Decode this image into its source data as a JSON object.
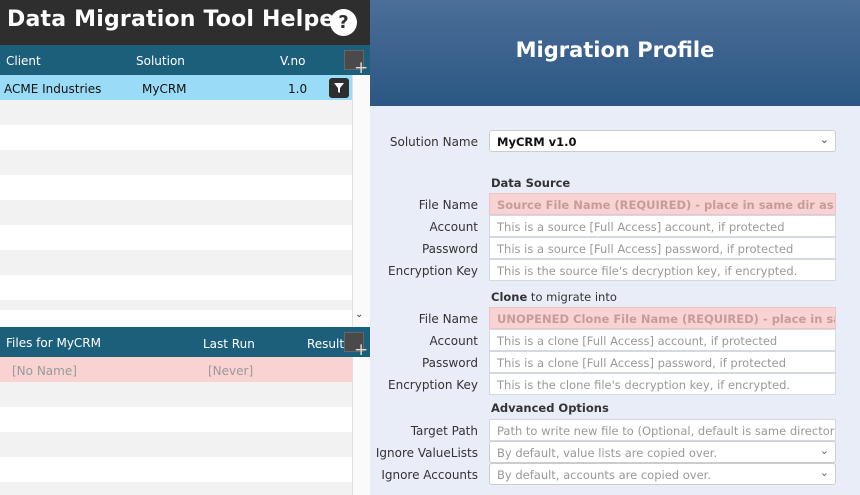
{
  "app": {
    "title": "Data Migration Tool Helper",
    "help_label": "?"
  },
  "clients": {
    "headers": {
      "client": "Client",
      "solution": "Solution",
      "version": "V.no"
    },
    "add_label": "+",
    "rows": [
      {
        "client": "ACME Industries",
        "solution": "MyCRM",
        "version": "1.0"
      }
    ]
  },
  "files": {
    "headers": {
      "files_for": "Files for MyCRM",
      "last_run": "Last Run",
      "result": "Result"
    },
    "add_label": "+",
    "rows": [
      {
        "name": "[No Name]",
        "last_run": "[Never]"
      }
    ]
  },
  "profile": {
    "title": "Migration Profile",
    "solution_name": {
      "label": "Solution Name",
      "value": "MyCRM v1.0"
    },
    "data_source": {
      "title": "Data Source",
      "file_name": {
        "label": "File Name",
        "placeholder": "Source File Name (REQUIRED) - place in same dir as this"
      },
      "account": {
        "label": "Account",
        "placeholder": "This is a source [Full Access] account, if protected"
      },
      "password": {
        "label": "Password",
        "placeholder": "This is a source [Full Access] password, if protected"
      },
      "encryption": {
        "label": "Encryption Key",
        "placeholder": "This is the source file's decryption key, if encrypted."
      }
    },
    "clone": {
      "title": "Clone to migrate into",
      "file_name": {
        "label": "File Name",
        "placeholder": "UNOPENED Clone File Name (REQUIRED) - place in same"
      },
      "account": {
        "label": "Account",
        "placeholder": "This is a clone [Full Access] account, if protected"
      },
      "password": {
        "label": "Password",
        "placeholder": "This is a clone [Full Access] password, if protected"
      },
      "encryption": {
        "label": "Encryption Key",
        "placeholder": "This is the clone file's decryption key, if encrypted."
      }
    },
    "advanced": {
      "title": "Advanced Options",
      "target_path": {
        "label": "Target Path",
        "placeholder": "Path to write new file to (Optional, default is same directory)"
      },
      "ignore_valuelists": {
        "label": "Ignore ValueLists",
        "value": "By default, value lists are copied over."
      },
      "ignore_accounts": {
        "label": "Ignore Accounts",
        "value": "By default, accounts are copied over."
      }
    }
  },
  "colors": {
    "header_dark": "#2e2e2e",
    "column_header": "#1c5f7b",
    "selected_row": "#9adcf7",
    "required_field": "#f8d3d3",
    "profile_header": "#2c5683",
    "profile_bg": "#e8edf8"
  },
  "icons": {
    "help": "question-icon",
    "filter": "funnel-icon",
    "add": "plus-icon",
    "dropdown": "chevron-down-icon"
  }
}
